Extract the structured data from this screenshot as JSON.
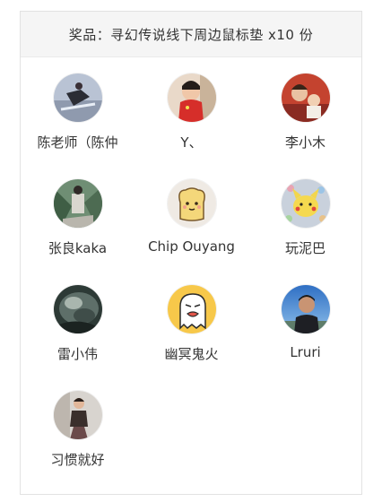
{
  "prize": {
    "title": "奖品：寻幻传说线下周边鼠标垫 x10 份"
  },
  "winners": [
    {
      "name": "陈老师（陈仲",
      "avatar": "photo-avatar-snow"
    },
    {
      "name": "Y、",
      "avatar": "photo-avatar-child-red"
    },
    {
      "name": "李小木",
      "avatar": "photo-avatar-family"
    },
    {
      "name": "张良kaka",
      "avatar": "photo-avatar-plants"
    },
    {
      "name": "Chip Ouyang",
      "avatar": "toast-cartoon-avatar"
    },
    {
      "name": "玩泥巴",
      "avatar": "pikachu-pattern-avatar"
    },
    {
      "name": "雷小伟",
      "avatar": "photo-avatar-rock"
    },
    {
      "name": "幽冥鬼火",
      "avatar": "ghost-cartoon-avatar"
    },
    {
      "name": "Lruri",
      "avatar": "photo-avatar-man-sky"
    },
    {
      "name": "习惯就好",
      "avatar": "photo-avatar-person"
    }
  ]
}
